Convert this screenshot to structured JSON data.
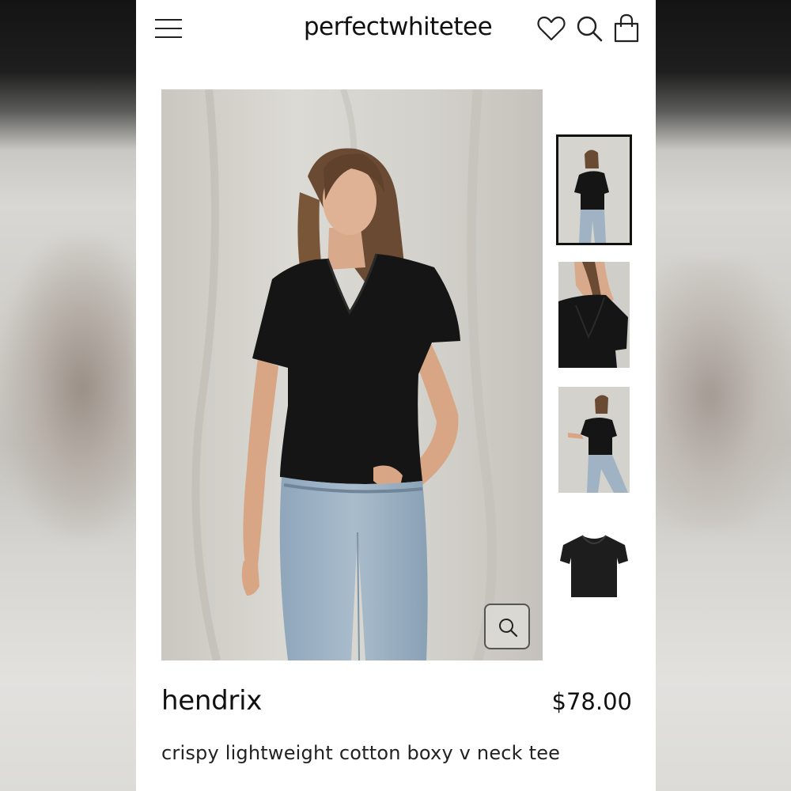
{
  "header": {
    "brand": "perfectwhitetee"
  },
  "product": {
    "name": "hendrix",
    "price": "$78.00",
    "description": "crispy lightweight cotton boxy v neck tee"
  },
  "gallery": {
    "thumbnail_count": 4,
    "active_index": 0
  },
  "icons": [
    "menu-icon",
    "heart-icon",
    "search-icon",
    "shopping-bag-icon",
    "zoom-icon"
  ],
  "colors": {
    "text": "#111111",
    "background": "#ffffff",
    "active_outline": "#111111"
  }
}
